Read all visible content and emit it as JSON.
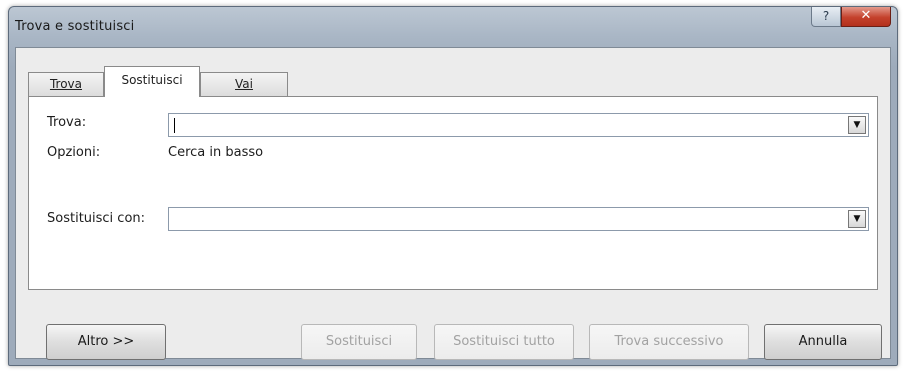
{
  "window": {
    "title": "Trova e sostituisci",
    "help_icon": "help-icon",
    "help_label": "?",
    "close_icon": "close-icon",
    "close_label": "✕"
  },
  "tabs": [
    {
      "label": "Trova",
      "active": false
    },
    {
      "label": "Sostituisci",
      "active": true
    },
    {
      "label": "Vai",
      "active": false
    }
  ],
  "find": {
    "label": "Trova:",
    "value": "",
    "dropdown_icon": "chevron-down-icon"
  },
  "options": {
    "label": "Opzioni:",
    "value": "Cerca in basso"
  },
  "replace": {
    "label": "Sostituisci con:",
    "value": "",
    "dropdown_icon": "chevron-down-icon"
  },
  "buttons": {
    "more": "Altro >>",
    "replace": "Sostituisci",
    "replace_all": "Sostituisci tutto",
    "find_next": "Trova successivo",
    "cancel": "Annulla"
  }
}
